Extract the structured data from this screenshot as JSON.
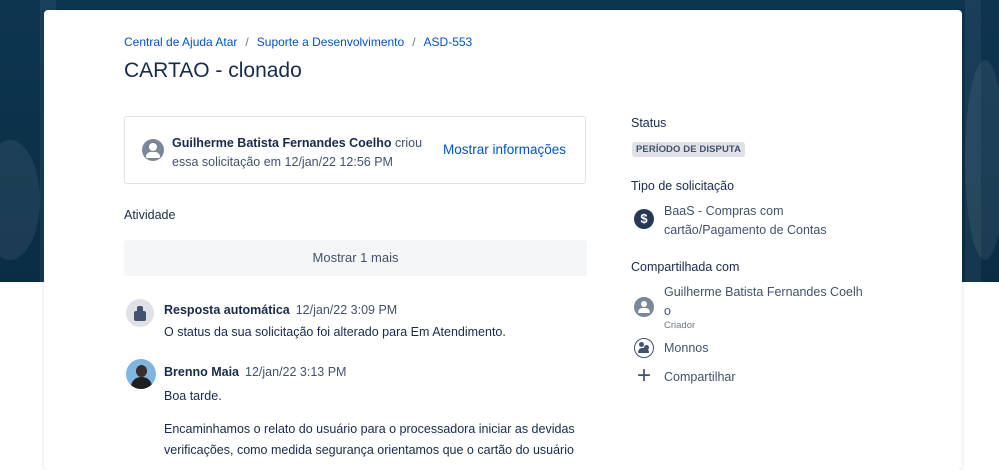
{
  "breadcrumb": {
    "items": [
      "Central de Ajuda Atar",
      "Suporte a Desenvolvimento",
      "ASD-553"
    ],
    "separator": "/"
  },
  "request": {
    "title": "CARTAO - clonado",
    "creator_name": "Guilherme Batista Fernandes Coelho",
    "creator_action": "criou",
    "creator_line2": "essa solicitação em 12/jan/22 12:56 PM",
    "show_info_label": "Mostrar informações"
  },
  "activity": {
    "label": "Atividade",
    "show_more_label": "Mostrar 1 mais",
    "comments": [
      {
        "author": "Resposta automática",
        "date": "12/jan/22 3:09 PM",
        "lines": [
          "O status da sua solicitação foi alterado para Em Atendimento."
        ]
      },
      {
        "author": "Brenno Maia",
        "date": "12/jan/22 3:13 PM",
        "lines": [
          "Boa tarde.",
          "Encaminhamos o relato do usuário para o processadora iniciar as devidas",
          "verificações, como medida segurança orientamos que o cartão do usuário"
        ]
      }
    ]
  },
  "sidebar": {
    "status_label": "Status",
    "status_value": "PERÍODO DE DISPUTA",
    "type_label": "Tipo de solicitação",
    "type_line1": "BaaS - Compras com",
    "type_line2": "cartão/Pagamento de Contas",
    "shared_label": "Compartilhada com",
    "shared_person_line1": "Guilherme Batista Fernandes Coelh",
    "shared_person_line2": "o",
    "shared_person_role": "Criador",
    "shared_group": "Monnos",
    "share_label": "Compartilhar"
  },
  "colors": {
    "link": "#0052cc",
    "hero_background": "#0e3550",
    "status_lozenge": "#dfe1e6"
  }
}
